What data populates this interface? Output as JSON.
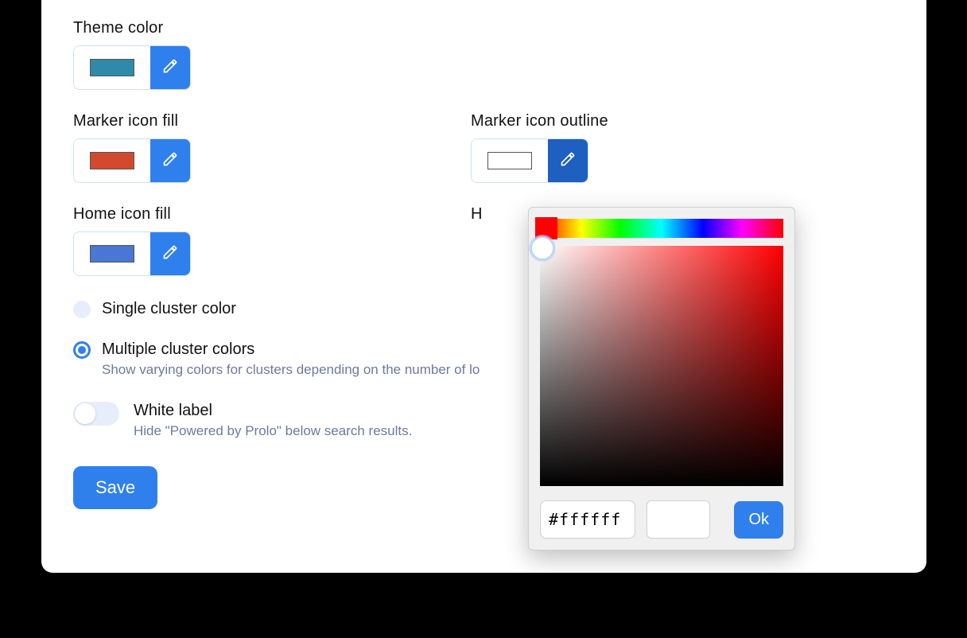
{
  "fields": {
    "theme_color": {
      "label": "Theme color",
      "swatch": "#2e8aa8"
    },
    "marker_fill": {
      "label": "Marker icon fill",
      "swatch": "#d2492e"
    },
    "marker_outline": {
      "label": "Marker icon outline",
      "swatch": "#ffffff"
    },
    "home_fill": {
      "label": "Home icon fill",
      "swatch": "#4a76d4"
    },
    "home_outline_prefix": "H"
  },
  "radios": {
    "single": {
      "label": "Single cluster color",
      "selected": false
    },
    "multiple": {
      "label": "Multiple cluster colors",
      "desc": "Show varying colors for clusters depending on the number of lo",
      "selected": true
    }
  },
  "toggle": {
    "title": "White label",
    "desc": "Hide \"Powered by Prolo\" below search results.",
    "on": false
  },
  "save_label": "Save",
  "picker": {
    "hex": "#ffffff",
    "ok_label": "Ok",
    "preview": "#ffffff"
  }
}
